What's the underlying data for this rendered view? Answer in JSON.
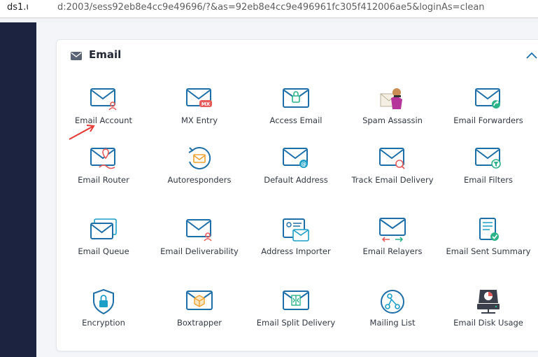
{
  "browser": {
    "url_host": "ds1.u",
    "url_path": "d:2003/sess92eb8e4cc9e49696/?&as=92eb8e4cc9e496961fc305f412006ae5&loginAs=clean"
  },
  "section": {
    "title": "Email",
    "icon": "envelope-icon",
    "collapse_icon": "chevron-up-icon"
  },
  "colors": {
    "sidebar": "#1c2340",
    "icon_blue": "#1e6fa8",
    "icon_teal": "#1c9fc7",
    "accent_red": "#e85b5b",
    "accent_green": "#2db38a",
    "arrow_red": "#e53935"
  },
  "tools": [
    {
      "label": "Email Account",
      "icon": "email-account-icon"
    },
    {
      "label": "MX Entry",
      "icon": "mx-entry-icon"
    },
    {
      "label": "Access Email",
      "icon": "access-email-icon"
    },
    {
      "label": "Spam Assassin",
      "icon": "spam-assassin-icon"
    },
    {
      "label": "Email Forwarders",
      "icon": "email-forwarders-icon"
    },
    {
      "label": "Email Router",
      "icon": "email-router-icon"
    },
    {
      "label": "Autoresponders",
      "icon": "autoresponders-icon"
    },
    {
      "label": "Default Address",
      "icon": "default-address-icon"
    },
    {
      "label": "Track Email Delivery",
      "icon": "track-email-delivery-icon"
    },
    {
      "label": "Email Filters",
      "icon": "email-filters-icon"
    },
    {
      "label": "Email Queue",
      "icon": "email-queue-icon"
    },
    {
      "label": "Email Deliverability",
      "icon": "email-deliverability-icon"
    },
    {
      "label": "Address Importer",
      "icon": "address-importer-icon"
    },
    {
      "label": "Email Relayers",
      "icon": "email-relayers-icon"
    },
    {
      "label": "Email Sent Summary",
      "icon": "email-sent-summary-icon"
    },
    {
      "label": "Encryption",
      "icon": "encryption-icon"
    },
    {
      "label": "Boxtrapper",
      "icon": "boxtrapper-icon"
    },
    {
      "label": "Email Split Delivery",
      "icon": "email-split-delivery-icon"
    },
    {
      "label": "Mailing List",
      "icon": "mailing-list-icon"
    },
    {
      "label": "Email Disk Usage",
      "icon": "email-disk-usage-icon"
    }
  ]
}
